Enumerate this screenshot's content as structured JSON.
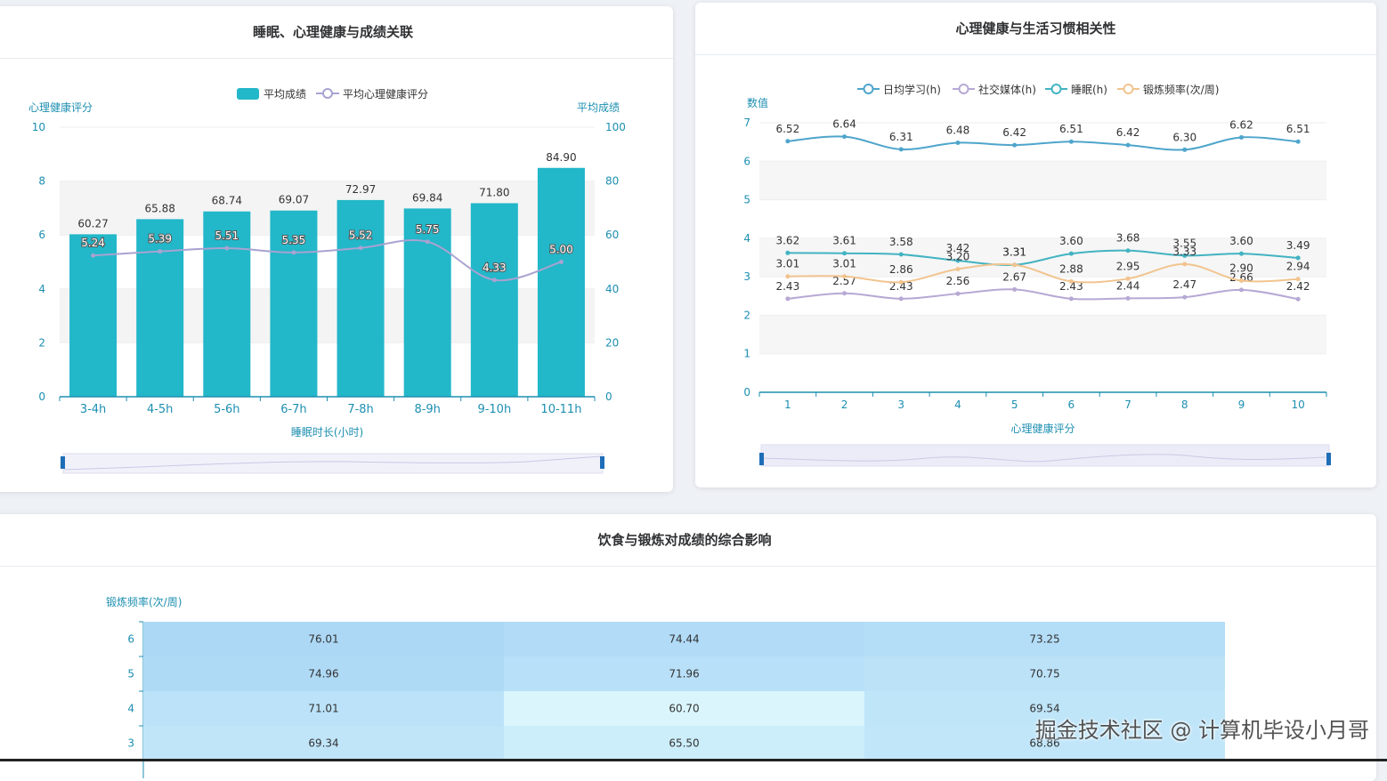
{
  "colors": {
    "bar": "#22b7c9",
    "axis": "#1d8fb0",
    "health_line": "#a8a3d1",
    "study": "#4ea5cc",
    "social": "#b7a8d4",
    "sleep": "#42b3c2",
    "exercise": "#f1c48f"
  },
  "watermark": "掘金技术社区 @ 计算机毕设小月哥",
  "cards": {
    "sleep": {
      "title": "睡眠、心理健康与成绩关联",
      "legend_bar": "平均成绩",
      "legend_line": "平均心理健康评分",
      "left_axis_name": "心理健康评分",
      "right_axis_name": "平均成绩",
      "x_axis_name": "睡眠时长(小时)"
    },
    "habits": {
      "title": "心理健康与生活习惯相关性",
      "y_axis_name": "数值",
      "x_axis_name": "心理健康评分"
    },
    "diet": {
      "title": "饮食与锻炼对成绩的综合影响",
      "y_axis_name": "锻炼频率(次/周)"
    }
  },
  "chart_data": [
    {
      "type": "bar",
      "title": "睡眠、心理健康与成绩关联",
      "xlabel": "睡眠时长(小时)",
      "categories": [
        "3-4h",
        "4-5h",
        "5-6h",
        "6-7h",
        "7-8h",
        "8-9h",
        "9-10h",
        "10-11h"
      ],
      "series": [
        {
          "name": "平均成绩",
          "type": "bar",
          "axis": "right",
          "values": [
            60.27,
            65.88,
            68.74,
            69.07,
            72.97,
            69.84,
            71.8,
            84.9
          ]
        },
        {
          "name": "平均心理健康评分",
          "type": "line",
          "axis": "left",
          "values": [
            5.24,
            5.39,
            5.51,
            5.35,
            5.52,
            5.75,
            4.33,
            5.0
          ]
        }
      ],
      "ylabel_left": "心理健康评分",
      "ylim_left": [
        0,
        10
      ],
      "left_ticks": [
        0,
        2,
        4,
        6,
        8,
        10
      ],
      "ylabel_right": "平均成绩",
      "ylim_right": [
        0,
        100
      ],
      "right_ticks": [
        0,
        20,
        40,
        60,
        80,
        100
      ],
      "legend": "top-center"
    },
    {
      "type": "line",
      "title": "心理健康与生活习惯相关性",
      "xlabel": "心理健康评分",
      "ylabel": "数值",
      "x": [
        1,
        2,
        3,
        4,
        5,
        6,
        7,
        8,
        9,
        10
      ],
      "ylim": [
        0,
        7
      ],
      "y_ticks": [
        0,
        1,
        2,
        3,
        4,
        5,
        6,
        7
      ],
      "series": [
        {
          "name": "日均学习(h)",
          "values": [
            6.52,
            6.64,
            6.31,
            6.48,
            6.42,
            6.51,
            6.42,
            6.3,
            6.62,
            6.51
          ]
        },
        {
          "name": "社交媒体(h)",
          "values": [
            2.43,
            2.57,
            2.43,
            2.56,
            2.67,
            2.43,
            2.44,
            2.47,
            2.66,
            2.42
          ]
        },
        {
          "name": "睡眠(h)",
          "values": [
            3.62,
            3.61,
            3.58,
            3.42,
            3.31,
            3.6,
            3.68,
            3.55,
            3.6,
            3.49
          ]
        },
        {
          "name": "锻炼频率(次/周)",
          "values": [
            3.01,
            3.01,
            2.86,
            3.2,
            3.31,
            2.88,
            2.95,
            3.33,
            2.9,
            2.94
          ]
        }
      ],
      "legend": "top-center"
    },
    {
      "type": "heatmap",
      "title": "饮食与锻炼对成绩的综合影响",
      "ylabel": "锻炼频率(次/周)",
      "y_categories": [
        6,
        5,
        4,
        3
      ],
      "columns": 3,
      "values": [
        [
          76.01,
          74.44,
          73.25
        ],
        [
          74.96,
          71.96,
          70.75
        ],
        [
          71.01,
          60.7,
          69.54
        ],
        [
          69.34,
          65.5,
          68.86
        ]
      ]
    }
  ]
}
